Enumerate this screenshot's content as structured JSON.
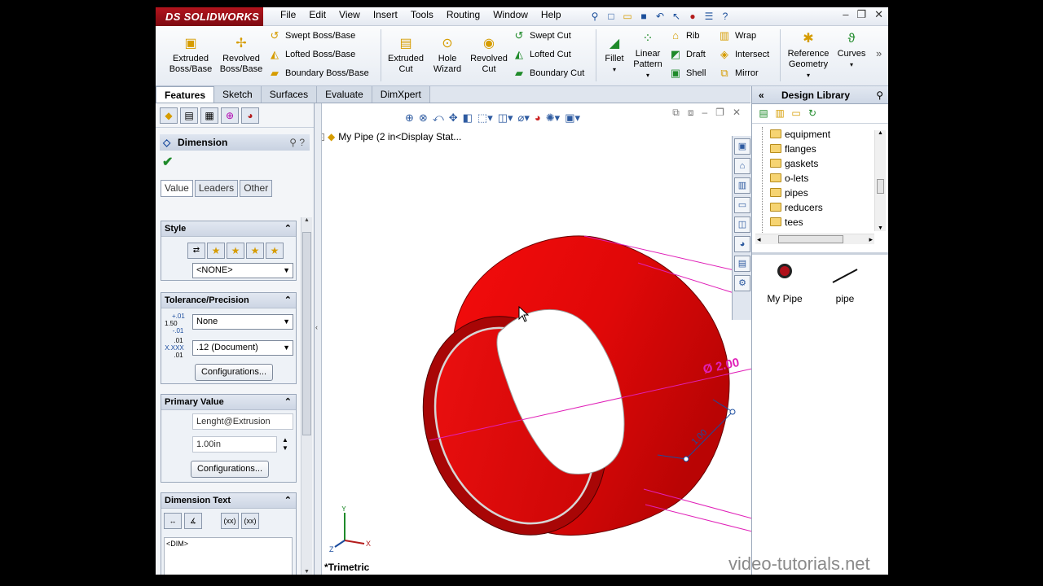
{
  "app": {
    "brand": "SOLIDWORKS",
    "brand_prefix": "DS"
  },
  "menu": [
    "File",
    "Edit",
    "View",
    "Insert",
    "Tools",
    "Routing",
    "Window",
    "Help"
  ],
  "ribbon": {
    "extruded_boss": "Extruded Boss/Base",
    "revolved_boss": "Revolved Boss/Base",
    "swept_boss": "Swept Boss/Base",
    "lofted_boss": "Lofted Boss/Base",
    "boundary_boss": "Boundary Boss/Base",
    "extruded_cut": "Extruded Cut",
    "hole_wizard": "Hole Wizard",
    "revolved_cut": "Revolved Cut",
    "swept_cut": "Swept Cut",
    "lofted_cut": "Lofted Cut",
    "boundary_cut": "Boundary Cut",
    "fillet": "Fillet",
    "linear_pattern": "Linear Pattern",
    "rib": "Rib",
    "draft": "Draft",
    "shell": "Shell",
    "wrap": "Wrap",
    "intersect": "Intersect",
    "mirror": "Mirror",
    "reference_geometry": "Reference Geometry",
    "curves": "Curves"
  },
  "tabs": [
    "Features",
    "Sketch",
    "Surfaces",
    "Evaluate",
    "DimXpert"
  ],
  "property_manager": {
    "title": "Dimension",
    "subtabs": [
      "Value",
      "Leaders",
      "Other"
    ],
    "style": {
      "header": "Style",
      "selected": "<NONE>"
    },
    "tolerance": {
      "header": "Tolerance/Precision",
      "type": "None",
      "precision": ".12 (Document)",
      "config_button": "Configurations...",
      "tol_icon_main": "1.50",
      "tol_icon_plus": "+.01",
      "tol_icon_minus": "-.01",
      "prec_icon_top": ".01",
      "prec_icon_main": "X.XXX",
      "prec_icon_bottom": ".01"
    },
    "primary_value": {
      "header": "Primary Value",
      "name": "Lenght@Extrusion",
      "value": "1.00in",
      "config_button": "Configurations..."
    },
    "dimension_text": {
      "header": "Dimension Text",
      "content": "<DIM>"
    }
  },
  "viewport": {
    "tree_label": "My Pipe  (2 in<Display Stat...",
    "view_label": "*Trimetric",
    "dim_diameter": "Ø 2.00",
    "dim_length": "1.00"
  },
  "design_library": {
    "title": "Design Library",
    "folders": [
      "equipment",
      "flanges",
      "gaskets",
      "o-lets",
      "pipes",
      "reducers",
      "tees"
    ],
    "items": [
      "My Pipe",
      "pipe"
    ]
  },
  "watermark": "video-tutorials.net",
  "colors": {
    "part": "#e00b0b",
    "dimension": "#e020b8",
    "accent": "#1b4c9e"
  }
}
